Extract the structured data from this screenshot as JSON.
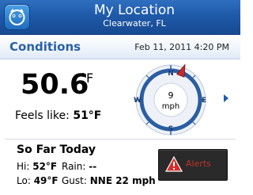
{
  "header": {
    "title": "My Location",
    "subtitle": "Clearwater, FL"
  },
  "conditions": {
    "label": "Conditions",
    "date": "Feb 11, 2011 4:20 PM",
    "temperature": "50.6",
    "temperature_unit": "°F",
    "feels_like_label": "Feels like:",
    "feels_like_value": "51°F"
  },
  "wind": {
    "speed": "9",
    "unit": "mph",
    "direction_labels": {
      "north": "N",
      "east": "E",
      "south": "S",
      "west": "W"
    },
    "needle_bearing_deg": 22
  },
  "today": {
    "title": "So Far Today",
    "hi_label": "Hi:",
    "hi_value": "52°F",
    "rain_label": "Rain:",
    "rain_value": "--",
    "lo_label": "Lo:",
    "lo_value": "49°F",
    "gust_label": "Gust:",
    "gust_value": "NNE 22 mph"
  },
  "alert_button": {
    "label": "Alerts",
    "icon": "warning-icon"
  },
  "icons": {
    "app": "weather-app-icon",
    "next": "chevron-right-icon"
  },
  "colors": {
    "titlebar": "#1f5aa9",
    "accent_text": "#2a5fa8",
    "compass_ring": "#2b5da3",
    "needle": "#c62a2a",
    "alert_text": "#c0322c"
  }
}
